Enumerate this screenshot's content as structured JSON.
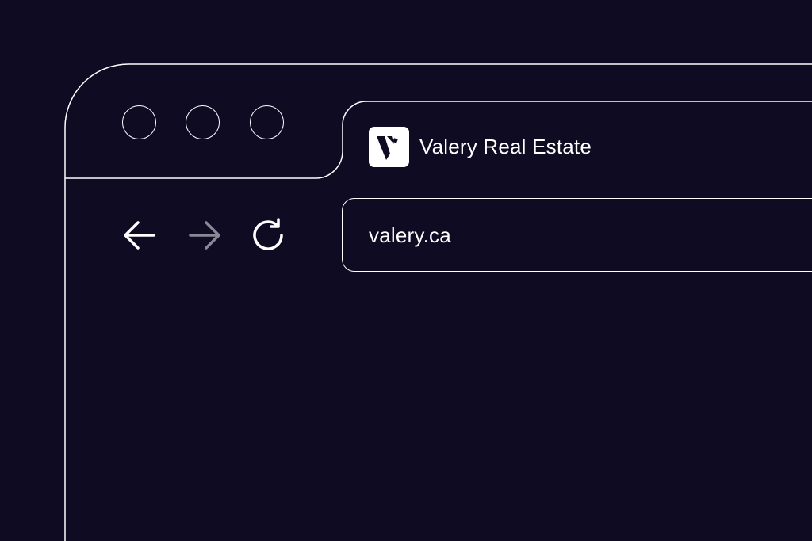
{
  "window": {
    "controls": [
      "close",
      "minimize",
      "maximize"
    ]
  },
  "tab": {
    "title": "Valery Real Estate",
    "favicon_icon": "valery-logo-icon"
  },
  "navigation": {
    "back_icon": "arrow-left-icon",
    "forward_icon": "arrow-right-icon",
    "reload_icon": "reload-icon",
    "forward_enabled": false
  },
  "address_bar": {
    "url": "valery.ca"
  },
  "colors": {
    "background": "#0e0b22",
    "foreground": "#ffffff",
    "disabled": "#8a8797"
  }
}
